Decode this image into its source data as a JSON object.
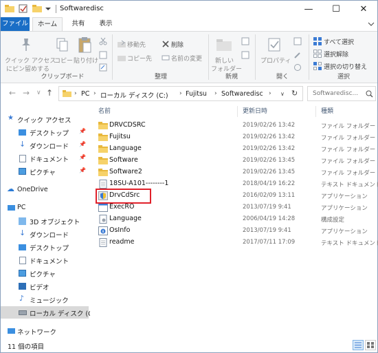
{
  "window": {
    "title": "Softwaredisc",
    "controls": {
      "minimize": "—",
      "maximize": "☐",
      "close": "✕"
    }
  },
  "ribbon_tabs": [
    {
      "label": "ファイル"
    },
    {
      "label": "ホーム"
    },
    {
      "label": "共有"
    },
    {
      "label": "表示"
    }
  ],
  "ribbon": {
    "clipboard": {
      "pin_label_1": "クイック アクセス",
      "pin_label_2": "にピン留めする",
      "copy": "コピー",
      "paste": "貼り付け",
      "group": "クリップボード"
    },
    "organize": {
      "move_to": "移動先",
      "copy_to": "コピー先",
      "delete": "削除",
      "rename": "名前の変更",
      "group": "整理"
    },
    "new": {
      "new_folder_1": "新しい",
      "new_folder_2": "フォルダー",
      "group": "新規"
    },
    "open": {
      "properties": "プロパティ",
      "group": "開く"
    },
    "select": {
      "select_all": "すべて選択",
      "select_none": "選択解除",
      "invert": "選択の切り替え",
      "group": "選択"
    }
  },
  "address": {
    "crumbs": [
      "PC",
      "ローカル ディスク (C:)",
      "Fujitsu",
      "Softwaredisc"
    ],
    "search_placeholder": "Softwaredisc..."
  },
  "nav": {
    "quick_access": "クイック アクセス",
    "quick_items": [
      "デスクトップ",
      "ダウンロード",
      "ドキュメント",
      "ピクチャ"
    ],
    "onedrive": "OneDrive",
    "pc": "PC",
    "pc_items": [
      "3D オブジェクト",
      "ダウンロード",
      "デスクトップ",
      "ドキュメント",
      "ピクチャ",
      "ビデオ",
      "ミュージック",
      "ローカル ディスク (C:)"
    ],
    "network": "ネットワーク"
  },
  "columns": {
    "name": "名前",
    "date": "更新日時",
    "type": "種類"
  },
  "files": [
    {
      "name": "DRVCDSRC",
      "date": "2019/02/26 13:42",
      "type": "ファイル フォルダー",
      "icon": "folder"
    },
    {
      "name": "Fujitsu",
      "date": "2019/02/26 13:42",
      "type": "ファイル フォルダー",
      "icon": "folder"
    },
    {
      "name": "Language",
      "date": "2019/02/26 13:42",
      "type": "ファイル フォルダー",
      "icon": "folder"
    },
    {
      "name": "Software",
      "date": "2019/02/26 13:45",
      "type": "ファイル フォルダー",
      "icon": "folder"
    },
    {
      "name": "Software2",
      "date": "2019/02/26 13:45",
      "type": "ファイル フォルダー",
      "icon": "folder"
    },
    {
      "name": "18SU-A101--------1",
      "date": "2018/04/19 16:22",
      "type": "テキスト ドキュメント",
      "icon": "text"
    },
    {
      "name": "DrvCdSrc",
      "date": "2016/02/09 13:11",
      "type": "アプリケーション",
      "icon": "app-shield"
    },
    {
      "name": "ExecRO",
      "date": "2013/07/19 9:41",
      "type": "アプリケーション",
      "icon": "app"
    },
    {
      "name": "Language",
      "date": "2006/04/19 14:28",
      "type": "構成設定",
      "icon": "config"
    },
    {
      "name": "OsInfo",
      "date": "2013/07/19 9:41",
      "type": "アプリケーション",
      "icon": "app-info"
    },
    {
      "name": "readme",
      "date": "2017/07/11 17:09",
      "type": "テキスト ドキュメント",
      "icon": "text"
    }
  ],
  "status": {
    "count": "11 個の項目"
  },
  "colors": {
    "accent": "#1a6ec6",
    "highlight": "#e0202a",
    "folder": "#e8b83c"
  }
}
